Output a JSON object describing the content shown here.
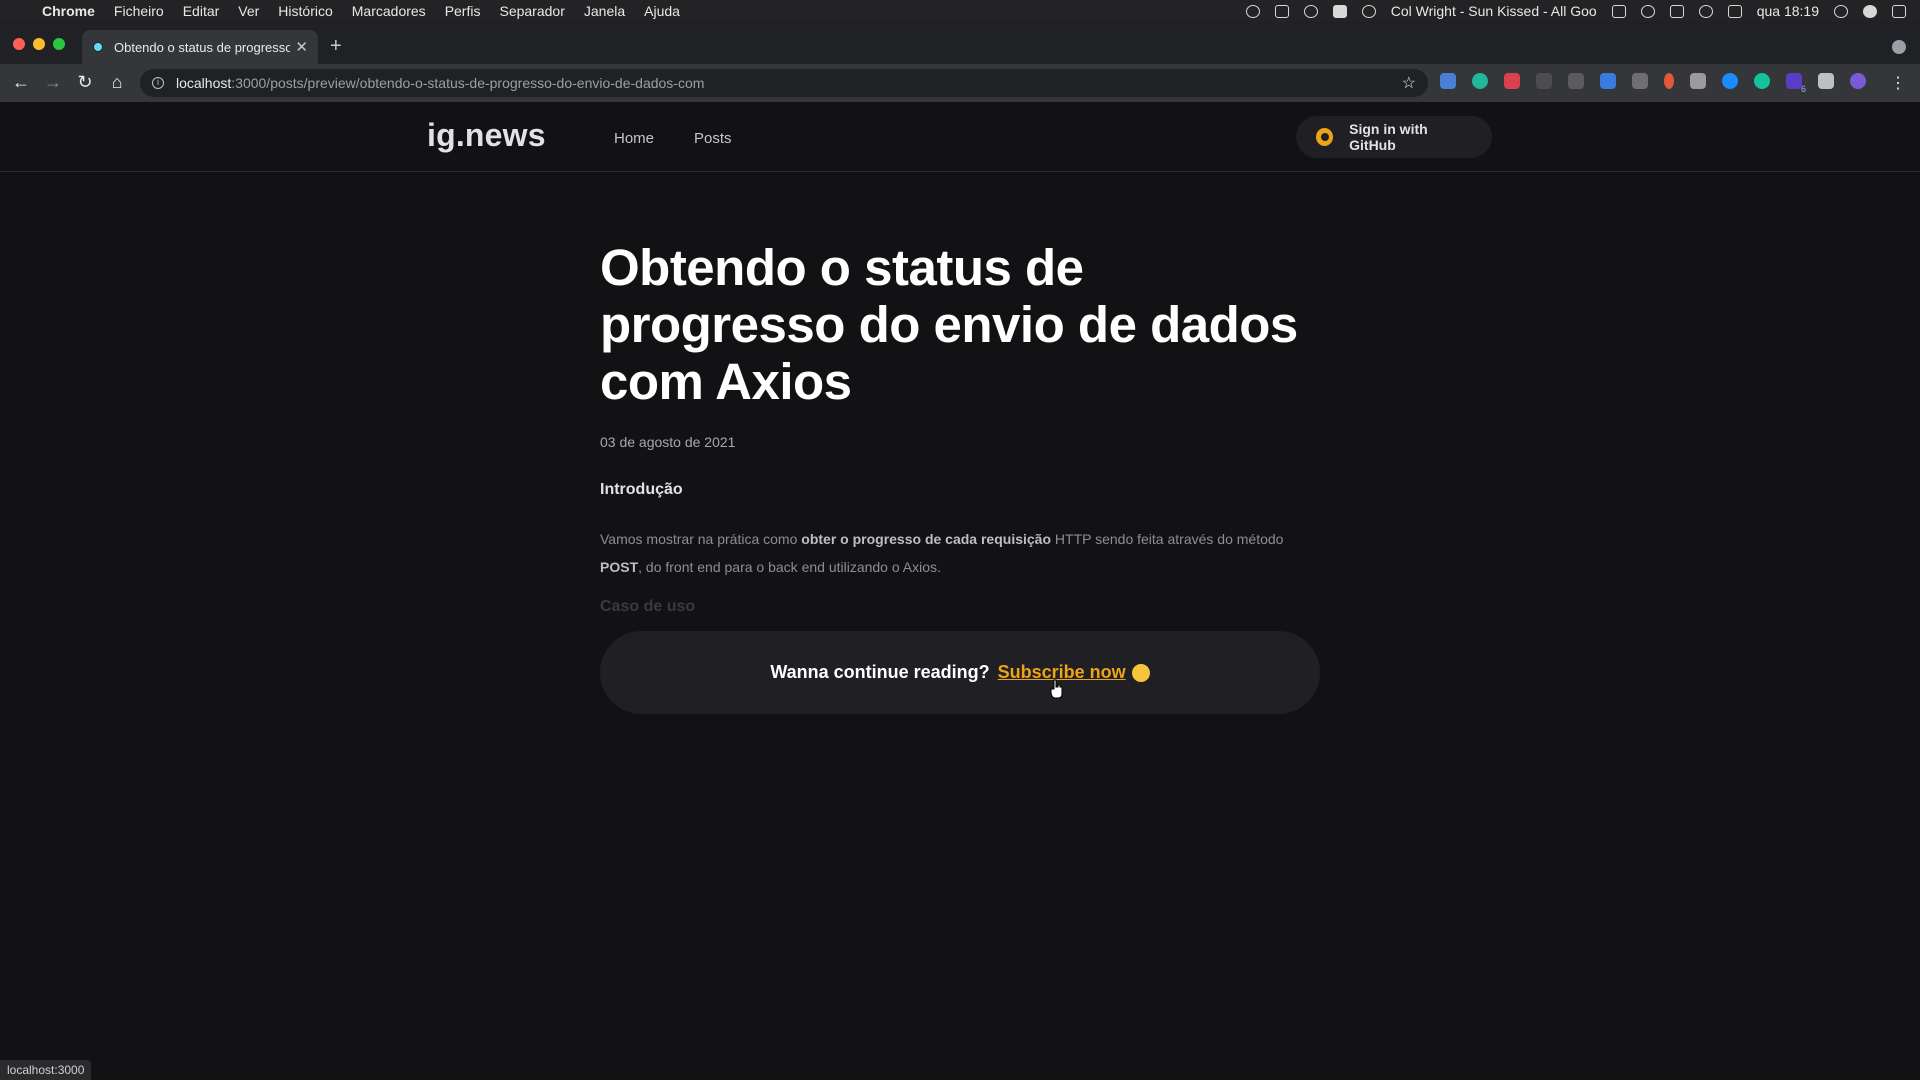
{
  "menubar": {
    "app_name": "Chrome",
    "menus": [
      "Ficheiro",
      "Editar",
      "Ver",
      "Histórico",
      "Marcadores",
      "Perfis",
      "Separador",
      "Janela",
      "Ajuda"
    ],
    "now_playing": "Col Wright - Sun Kissed - All Goo",
    "clock": "qua 18:19"
  },
  "browser": {
    "tab_title": "Obtendo o status de progresso",
    "url_host": "localhost",
    "url_path": ":3000/posts/preview/obtendo-o-status-de-progresso-do-envio-de-dados-com",
    "extension_badge": "6",
    "status_url": "localhost:3000"
  },
  "site": {
    "logo": "ig.news",
    "nav": {
      "home": "Home",
      "posts": "Posts"
    },
    "signin_label": "Sign in with GitHub",
    "accent_color": "#eba417"
  },
  "post": {
    "title": "Obtendo o status de progresso do envio de dados com Axios",
    "date": "03 de agosto de 2021",
    "heading": "Introdução",
    "paragraph": {
      "part1": "Vamos mostrar na prática como ",
      "bold1": "obter o progresso de cada requisição",
      "part2": " HTTP sendo feita através do método ",
      "bold2": "POST",
      "part3": ", do front end para o back end utilizando o Axios."
    },
    "faded_heading": "Caso de uso"
  },
  "cta": {
    "text": "Wanna continue reading?",
    "link": "Subscribe now"
  }
}
